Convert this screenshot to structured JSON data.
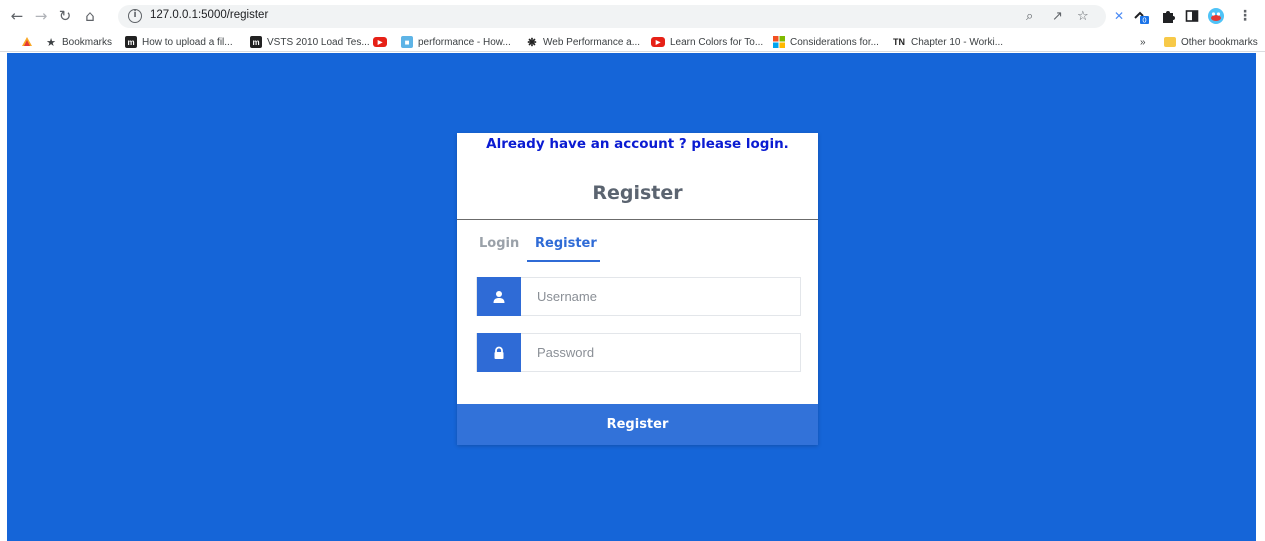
{
  "browser": {
    "url": "127.0.0.1:5000/register",
    "bookmarks": [
      {
        "label": "Bookmarks",
        "icon": "star-icon"
      },
      {
        "label": "How to upload a fil...",
        "icon": "m-logo-icon"
      },
      {
        "label": "VSTS 2010 Load Tes...",
        "icon": "m-logo-icon"
      },
      {
        "label": "",
        "icon": "youtube-icon"
      },
      {
        "label": "performance - How...",
        "icon": "stackexchange-icon"
      },
      {
        "label": "Web Performance a...",
        "icon": "site-icon"
      },
      {
        "label": "Learn Colors for To...",
        "icon": "youtube-icon"
      },
      {
        "label": "Considerations for...",
        "icon": "microsoft-icon"
      },
      {
        "label": "Chapter 10 - Worki...",
        "icon": "tn-icon"
      }
    ],
    "overflow_label": "»",
    "other_bookmarks": "Other bookmarks",
    "tn_text": "TN"
  },
  "card": {
    "already_link": "Already have an account ? please login.",
    "title": "Register",
    "tabs": [
      {
        "label": "Login",
        "active": false
      },
      {
        "label": "Register",
        "active": true
      }
    ],
    "username": {
      "placeholder": "Username",
      "value": ""
    },
    "password": {
      "placeholder": "Password",
      "value": ""
    },
    "submit_label": "Register"
  },
  "colors": {
    "page_bg": "#1565d8",
    "accent": "#2f6bd6",
    "link": "#0a1bd2",
    "button": "#3272d9"
  }
}
